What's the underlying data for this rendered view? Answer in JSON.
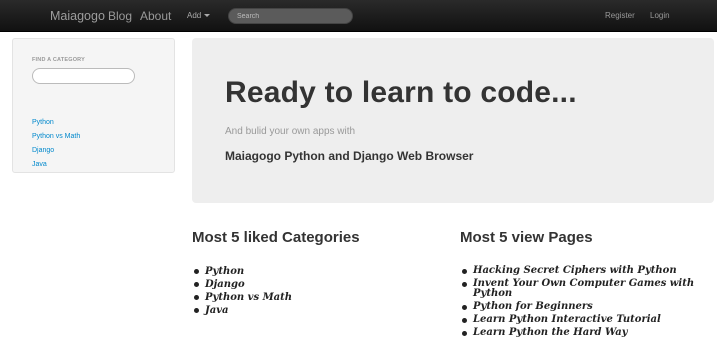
{
  "navbar": {
    "brand": "Maiagogo",
    "blog": "Blog",
    "about": "About",
    "add": "Add",
    "search_placeholder": "Search",
    "register": "Register",
    "login": "Login"
  },
  "sidebar": {
    "header": "FIND A CATEGORY",
    "categories": [
      "Python",
      "Python vs Math",
      "Django",
      "Java"
    ]
  },
  "hero": {
    "title": "Ready to learn to code...",
    "subtitle": "And bulid your own apps with",
    "strong": "Maiagogo Python and Django Web Browser"
  },
  "liked": {
    "title": "Most 5 liked Categories",
    "items": [
      "Python",
      "Django",
      "Python vs Math",
      "Java"
    ]
  },
  "viewed": {
    "title": "Most 5 view Pages",
    "items": [
      "Hacking Secret Ciphers with Python",
      "Invent Your Own Computer Games with Python",
      "Python for Beginners",
      "Learn Python Interactive Tutorial",
      "Learn Python the Hard Way"
    ]
  }
}
